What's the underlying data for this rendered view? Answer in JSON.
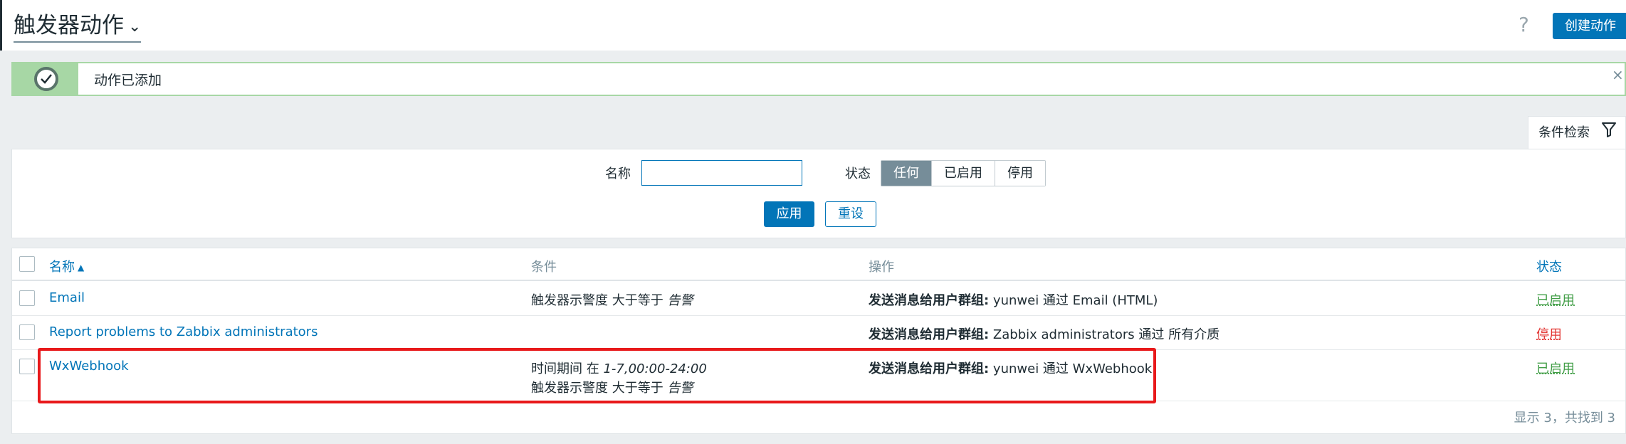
{
  "header": {
    "title": "触发器动作",
    "help_symbol": "?",
    "create_button": "创建动作"
  },
  "message": {
    "text": "动作已添加",
    "close_symbol": "×",
    "colors": {
      "border": "#a7d7a5",
      "icon": "#59746a"
    }
  },
  "filter": {
    "tab_label": "条件检索",
    "name_label": "名称",
    "name_value": "",
    "status_label": "状态",
    "status_options": [
      "任何",
      "已启用",
      "停用"
    ],
    "status_selected": "任何",
    "apply_button": "应用",
    "reset_button": "重设"
  },
  "table": {
    "columns": [
      "名称",
      "条件",
      "操作",
      "状态"
    ],
    "rows": [
      {
        "name": "Email",
        "conditions": [
          {
            "prefix": "触发器示警度 大于等于 ",
            "value": "告警"
          }
        ],
        "op_label": "发送消息给用户群组:",
        "op_text": " yunwei 通过 Email (HTML)",
        "status": "已启用"
      },
      {
        "name": "Report problems to Zabbix administrators",
        "conditions": [],
        "op_label": "发送消息给用户群组:",
        "op_text": " Zabbix administrators 通过 所有介质",
        "status": "停用"
      },
      {
        "name": "WxWebhook",
        "conditions": [
          {
            "prefix": "时间期间 在 ",
            "value": "1-7,00:00-24:00"
          },
          {
            "prefix": "触发器示警度 大于等于 ",
            "value": "告警"
          }
        ],
        "op_label": "发送消息给用户群组:",
        "op_text": " yunwei 通过 WxWebhook",
        "status": "已启用"
      }
    ],
    "footer": "显示 3，共找到 3"
  },
  "colors": {
    "accent": "#0275b8",
    "enabled": "#429e47",
    "disabled": "#e33734",
    "highlight": "#e8191b"
  }
}
